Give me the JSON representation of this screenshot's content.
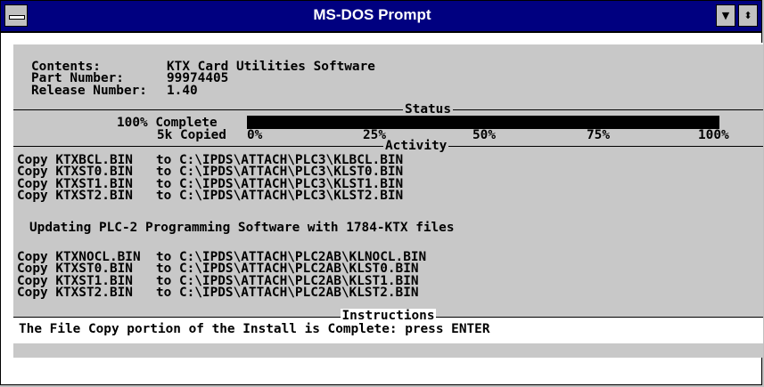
{
  "window": {
    "title": "MS-DOS Prompt",
    "minimize_glyph": "▼",
    "maximize_glyph": "⬍"
  },
  "header": {
    "contents_label": "Contents:",
    "contents_value": "KTX Card Utilities Software",
    "part_label": "Part Number:",
    "part_value": "99974405",
    "release_label": "Release Number:",
    "release_value": "1.40"
  },
  "status": {
    "label": "Status",
    "percent_text": "100% Complete",
    "copied_text": "5k Copied",
    "progress_fraction": 1.0,
    "scale": [
      "0%",
      "25%",
      "50%",
      "75%",
      "100%"
    ]
  },
  "activity": {
    "label": "Activity",
    "lines_plc3": [
      "Copy KTXBCL.BIN   to C:\\IPDS\\ATTACH\\PLC3\\KLBCL.BIN",
      "Copy KTXST0.BIN   to C:\\IPDS\\ATTACH\\PLC3\\KLST0.BIN",
      "Copy KTXST1.BIN   to C:\\IPDS\\ATTACH\\PLC3\\KLST1.BIN",
      "Copy KTXST2.BIN   to C:\\IPDS\\ATTACH\\PLC3\\KLST2.BIN"
    ],
    "update_message": "Updating PLC-2 Programming Software with 1784-KTX files",
    "lines_plc2": [
      "Copy KTXNOCL.BIN  to C:\\IPDS\\ATTACH\\PLC2AB\\KLNOCL.BIN",
      "Copy KTXST0.BIN   to C:\\IPDS\\ATTACH\\PLC2AB\\KLST0.BIN",
      "Copy KTXST1.BIN   to C:\\IPDS\\ATTACH\\PLC2AB\\KLST1.BIN",
      "Copy KTXST2.BIN   to C:\\IPDS\\ATTACH\\PLC2AB\\KLST2.BIN"
    ]
  },
  "instructions": {
    "label": "Instructions",
    "text": "The File Copy portion of the Install is Complete: press ENTER"
  },
  "colors": {
    "titlebar": "#000080",
    "console_bg": "#c8c8c8",
    "progress_fill": "#000000"
  }
}
